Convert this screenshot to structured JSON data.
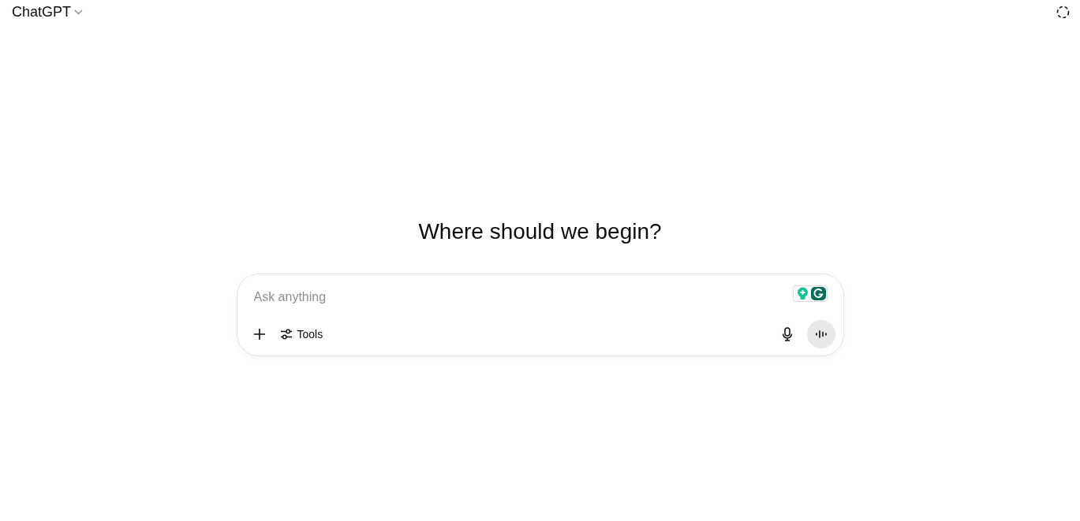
{
  "header": {
    "title": "ChatGPT"
  },
  "heading": "Where should we begin?",
  "composer": {
    "placeholder": "Ask anything",
    "tools_label": "Tools"
  }
}
